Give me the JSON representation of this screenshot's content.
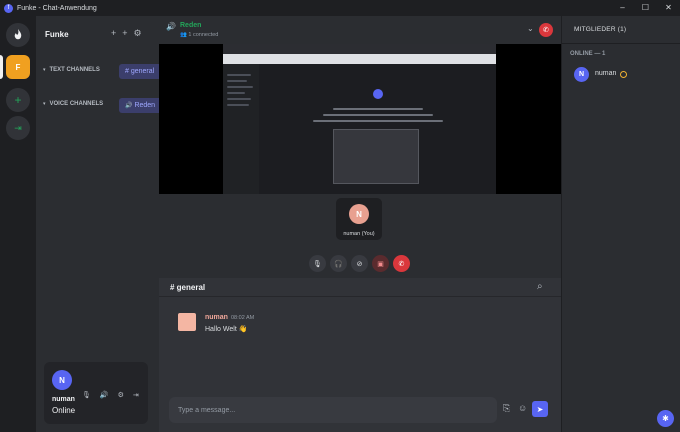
{
  "window": {
    "title": "Funke - Chat-Anwendung",
    "app_icon": "f",
    "controls": [
      "–",
      "☐",
      "✕"
    ]
  },
  "rail": {
    "home_icon": "flame-icon",
    "server_letter": "F",
    "add_symbol": "+",
    "join_symbol": "⇥"
  },
  "server": {
    "name": "Funke",
    "categories": [
      {
        "label": "TEXT CHANNELS",
        "channel": "general",
        "channel_prefix": "#"
      },
      {
        "label": "VOICE CHANNELS",
        "channel": "Reden",
        "channel_prefix": "🔊"
      }
    ]
  },
  "user_panel": {
    "avatar_letter": "N",
    "name": "numan",
    "status": "Online"
  },
  "voice": {
    "channel_name": "Reden",
    "connected_text": "1 connected"
  },
  "participant": {
    "avatar_letter": "N",
    "label": "numan (You)"
  },
  "chat": {
    "channel": "# general",
    "messages": [
      {
        "author": "numan",
        "time": "08:02 AM",
        "text": "Hallo Welt 👋"
      }
    ],
    "composer_placeholder": "Type a message..."
  },
  "members": {
    "header": "MITGLIEDER (1)",
    "online_header": "ONLINE — 1",
    "list": [
      {
        "avatar_letter": "N",
        "name": "numan",
        "status": "idle"
      }
    ]
  },
  "colors": {
    "accent": "#5865f2",
    "voice_green": "#23a55a",
    "danger": "#da373c",
    "server_orange": "#f0a020",
    "author_color": "#f0a79a"
  }
}
